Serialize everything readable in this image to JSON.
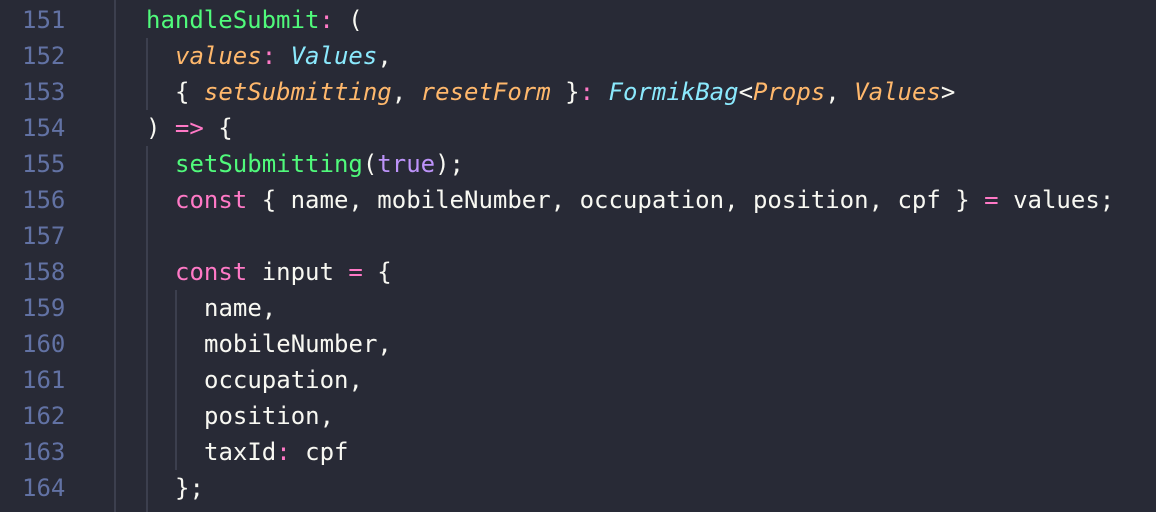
{
  "line_numbers": [
    "151",
    "152",
    "153",
    "154",
    "155",
    "156",
    "157",
    "158",
    "159",
    "160",
    "161",
    "162",
    "163",
    "164"
  ],
  "lines": {
    "l151": {
      "fn": "handleSubmit",
      "colon": ":",
      "open": " ("
    },
    "l152": {
      "param": "values",
      "colon": ":",
      "sp": " ",
      "type": "Values",
      "comma": ","
    },
    "l153": {
      "open": "{ ",
      "p1": "setSubmitting",
      "c1": ", ",
      "p2": "resetForm",
      "close": " }",
      "colon": ":",
      "sp": " ",
      "type": "FormikBag",
      "lt": "<",
      "t1": "Props",
      "c2": ", ",
      "t2": "Values",
      "gt": ">"
    },
    "l154": {
      "paren": ") ",
      "arrow": "=>",
      "brace": " {"
    },
    "l155": {
      "fn": "setSubmitting",
      "open": "(",
      "kw": "true",
      "close": ");"
    },
    "l156": {
      "kw": "const",
      "rest": " { name, mobileNumber, occupation, position, cpf } ",
      "eq": "=",
      "tail": " values;"
    },
    "l158": {
      "kw": "const",
      "name": " input ",
      "eq": "=",
      "brace": " {"
    },
    "l159": {
      "text": "name,"
    },
    "l160": {
      "text": "mobileNumber,"
    },
    "l161": {
      "text": "occupation,"
    },
    "l162": {
      "text": "position,"
    },
    "l163": {
      "key": "taxId",
      "colon": ":",
      "val": " cpf"
    },
    "l164": {
      "text": "};"
    }
  }
}
